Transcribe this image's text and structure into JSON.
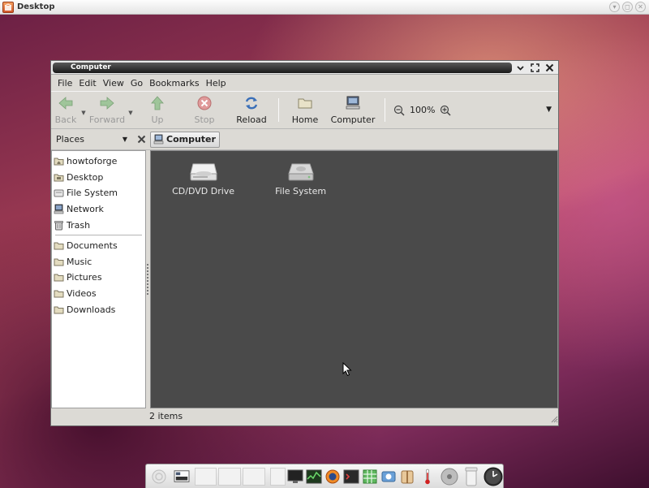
{
  "desktop": {
    "title": "Desktop"
  },
  "window": {
    "title": "Computer"
  },
  "menu": [
    {
      "label": "File"
    },
    {
      "label": "Edit"
    },
    {
      "label": "View"
    },
    {
      "label": "Go"
    },
    {
      "label": "Bookmarks"
    },
    {
      "label": "Help"
    }
  ],
  "toolbar": {
    "back": "Back",
    "forward": "Forward",
    "up": "Up",
    "stop": "Stop",
    "reload": "Reload",
    "home": "Home",
    "computer": "Computer",
    "zoom": "100%"
  },
  "places": {
    "title": "Places",
    "items": [
      "howtoforge",
      "Desktop",
      "File System",
      "Network",
      "Trash"
    ],
    "bookmarks": [
      "Documents",
      "Music",
      "Pictures",
      "Videos",
      "Downloads"
    ]
  },
  "location": {
    "crumb": "Computer"
  },
  "files": [
    {
      "label": "CD/DVD Drive",
      "icon": "optical-drive-icon"
    },
    {
      "label": "File System",
      "icon": "hard-drive-icon"
    }
  ],
  "status": {
    "text": "2 items"
  },
  "colors": {
    "iconview_bg": "#4a4a4a",
    "titlebar_active": "#1a1a1a",
    "toolbar_bg": "#dcdad5"
  }
}
